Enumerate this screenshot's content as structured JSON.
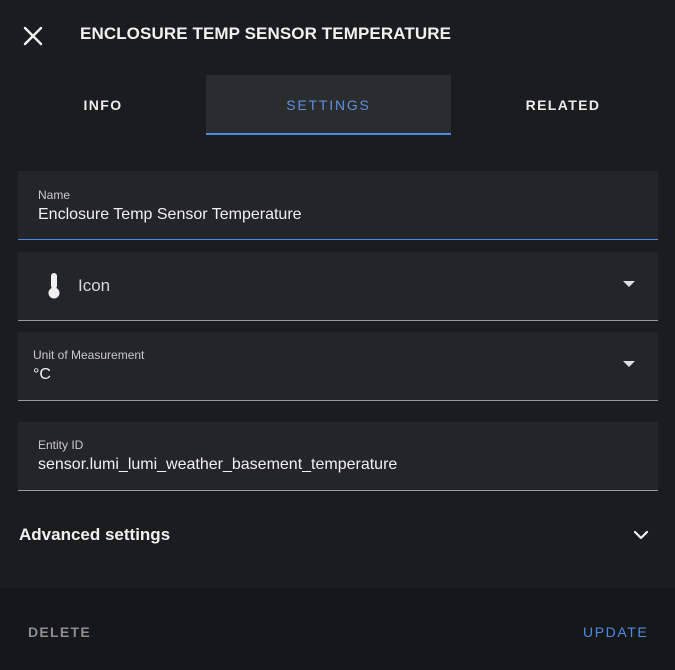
{
  "dialog": {
    "title": "ENCLOSURE TEMP SENSOR TEMPERATURE"
  },
  "tabs": [
    {
      "label": "INFO",
      "active": false
    },
    {
      "label": "SETTINGS",
      "active": true
    },
    {
      "label": "RELATED",
      "active": false
    }
  ],
  "form": {
    "name": {
      "label": "Name",
      "value": "Enclosure Temp Sensor Temperature"
    },
    "icon": {
      "label": "Icon",
      "icon_name": "thermometer-icon"
    },
    "unit": {
      "label": "Unit of Measurement",
      "value": "°C"
    },
    "entity_id": {
      "label": "Entity ID",
      "value": "sensor.lumi_lumi_weather_basement_temperature"
    }
  },
  "advanced": {
    "label": "Advanced settings"
  },
  "footer": {
    "delete_label": "DELETE",
    "update_label": "UPDATE"
  },
  "colors": {
    "accent": "#4d8ae6",
    "background": "#1b1c1e",
    "field_background": "#242528"
  }
}
